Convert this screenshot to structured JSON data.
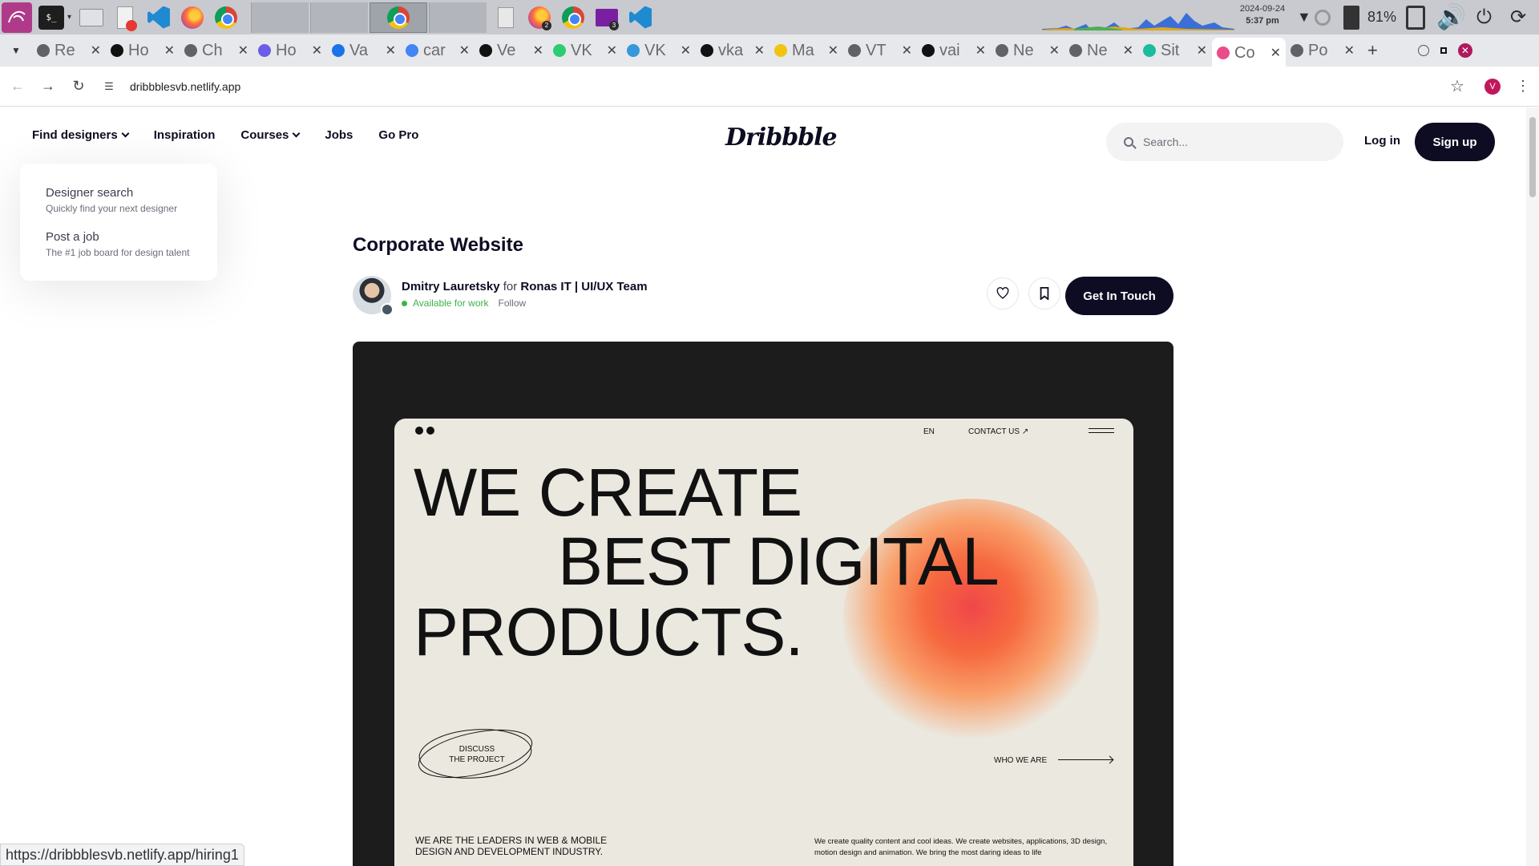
{
  "taskbar": {
    "apps": [
      "kali-menu-icon",
      "terminal-icon",
      "file-manager-icon",
      "text-editor-icon",
      "vscode-icon",
      "firefox-icon",
      "chrome-icon"
    ],
    "window_badges": [
      "2",
      "3"
    ],
    "clock_date": "2024-09-24",
    "clock_time": "5:37 pm",
    "battery": "81%"
  },
  "tabs": [
    {
      "title": "Re",
      "color": "#5f6368"
    },
    {
      "title": "Ho",
      "color": "#111111"
    },
    {
      "title": "Ch",
      "color": "#5f6368"
    },
    {
      "title": "Ho",
      "color": "#6c5ce7"
    },
    {
      "title": "Va",
      "color": "#1a73e8"
    },
    {
      "title": "car",
      "color": "#4285f4"
    },
    {
      "title": "Ve",
      "color": "#111111"
    },
    {
      "title": "VK",
      "color": "#2ecc71"
    },
    {
      "title": "VK",
      "color": "#3498db"
    },
    {
      "title": "vka",
      "color": "#111111"
    },
    {
      "title": "Ma",
      "color": "#f1c40f"
    },
    {
      "title": "VT",
      "color": "#5f6368"
    },
    {
      "title": "vai",
      "color": "#111111"
    },
    {
      "title": "Ne",
      "color": "#5f6368"
    },
    {
      "title": "Ne",
      "color": "#5f6368"
    },
    {
      "title": "Sit",
      "color": "#1abc9c"
    },
    {
      "title": "Co",
      "color": "#ea4c89",
      "active": true
    },
    {
      "title": "Po",
      "color": "#5f6368"
    }
  ],
  "address_bar": {
    "url": "dribbblesvb.netlify.app",
    "profile_initial": "V"
  },
  "site": {
    "nav": {
      "find_designers": "Find designers",
      "inspiration": "Inspiration",
      "courses": "Courses",
      "jobs": "Jobs",
      "go_pro": "Go Pro"
    },
    "logo": "Dribbble",
    "search_placeholder": "Search...",
    "login": "Log in",
    "signup": "Sign up",
    "dropdown": [
      {
        "title": "Designer search",
        "subtitle": "Quickly find your next designer"
      },
      {
        "title": "Post a job",
        "subtitle": "The #1 job board for design talent"
      }
    ]
  },
  "shot": {
    "title": "Corporate Website",
    "author": "Dmitry Lauretsky",
    "for_label": "for",
    "team": "Ronas IT | UI/UX Team",
    "availability": "Available for work",
    "follow": "Follow",
    "cta": "Get In Touch"
  },
  "mockup": {
    "lang": "EN",
    "contact": "CONTACT US ↗",
    "hero_line1": "WE CREATE",
    "hero_line2": "BEST DIGITAL",
    "hero_line3": "PRODUCTS.",
    "discuss_line1": "DISCUSS",
    "discuss_line2": "THE PROJECT",
    "who_we_are": "WHO WE ARE",
    "leaders": "WE ARE THE LEADERS IN WEB & MOBILE DESIGN  AND DEVELOPMENT INDUSTRY.",
    "description": "We create quality content and cool ideas. We create websites, applications, 3D design, motion design and animation. We bring the most daring ideas to life"
  },
  "status_bar": {
    "hover_url": "https://dribbblesvb.netlify.app/hiring1"
  }
}
